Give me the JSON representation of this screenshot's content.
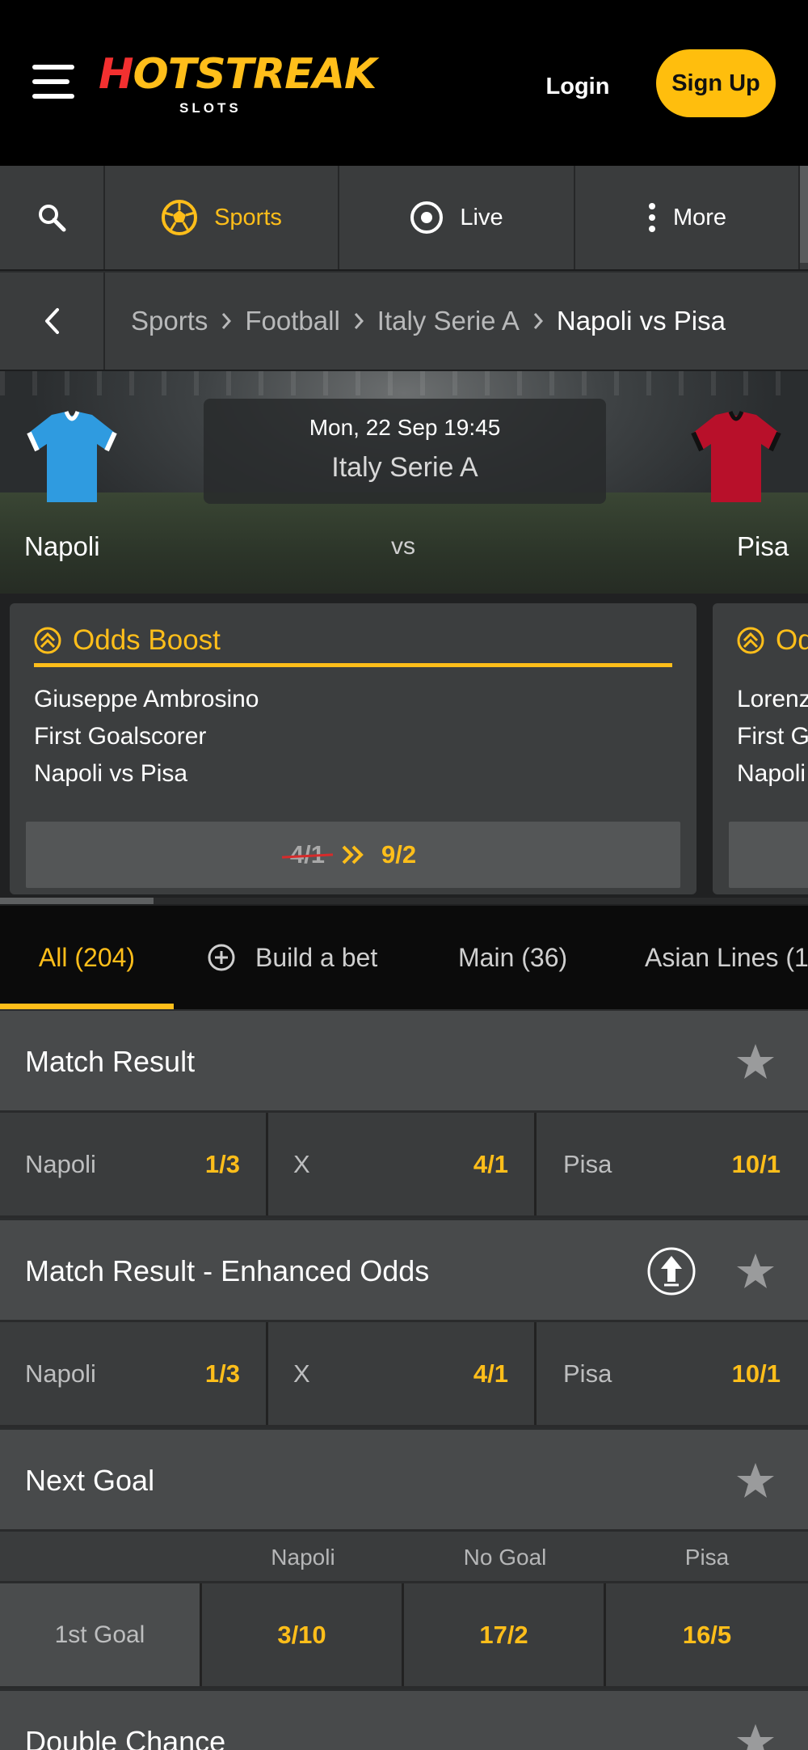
{
  "header": {
    "logo_text_hot": "H",
    "logo_text_o": "O",
    "logo_text_rest": "TSTREAK",
    "logo_sub": "SLOTS",
    "login_label": "Login",
    "signup_label": "Sign Up"
  },
  "nav": {
    "items": [
      {
        "label": "Sports",
        "icon": "football-icon",
        "active": true
      },
      {
        "label": "Live",
        "icon": "live-icon"
      },
      {
        "label": "More",
        "icon": "more-vertical-icon"
      }
    ]
  },
  "breadcrumb": [
    "Sports",
    "Football",
    "Italy Serie A",
    "Napoli vs Pisa"
  ],
  "event": {
    "datetime": "Mon, 22 Sep 19:45",
    "competition": "Italy Serie A",
    "home": "Napoli",
    "away": "Pisa",
    "vs": "vs",
    "home_color": "#2f9be0",
    "away_color": "#b8102a"
  },
  "boosts": [
    {
      "title": "Odds Boost",
      "lines": [
        "Giuseppe Ambrosino",
        "First Goalscorer",
        "Napoli vs Pisa"
      ],
      "old_odds": "4/1",
      "new_odds": "9/2"
    },
    {
      "title": "Odds Boost",
      "lines": [
        "Lorenz",
        "First G",
        "Napoli"
      ]
    }
  ],
  "tabs": [
    "All (204)",
    "Build a bet",
    "Main (36)",
    "Asian Lines (1"
  ],
  "markets": {
    "match_result": {
      "title": "Match Result",
      "selections": [
        {
          "name": "Napoli",
          "odds": "1/3"
        },
        {
          "name": "X",
          "odds": "4/1"
        },
        {
          "name": "Pisa",
          "odds": "10/1"
        }
      ]
    },
    "enhanced": {
      "title": "Match Result - Enhanced Odds",
      "selections": [
        {
          "name": "Napoli",
          "odds": "1/3"
        },
        {
          "name": "X",
          "odds": "4/1"
        },
        {
          "name": "Pisa",
          "odds": "10/1"
        }
      ]
    },
    "next_goal": {
      "title": "Next Goal",
      "columns": [
        "Napoli",
        "No Goal",
        "Pisa"
      ],
      "row_label": "1st Goal",
      "odds": [
        "3/10",
        "17/2",
        "16/5"
      ]
    },
    "double_chance": {
      "title": "Double Chance"
    }
  },
  "colors": {
    "accent": "#ffbe1a",
    "brand_red": "#f33030"
  }
}
